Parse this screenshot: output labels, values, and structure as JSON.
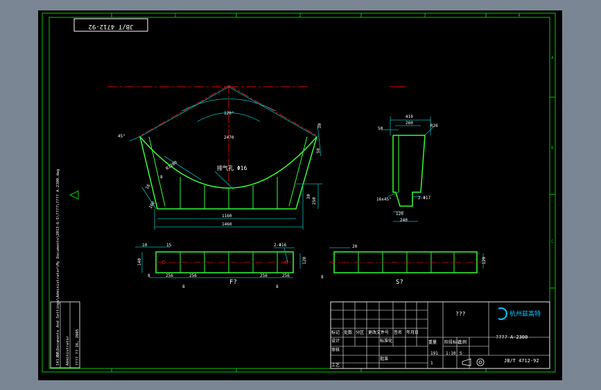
{
  "drawing": {
    "standard_box": "JB/T 4712-92",
    "grid_cols": [
      "1",
      "2",
      "3",
      "4"
    ],
    "grid_rows": [
      "A",
      "B",
      "C"
    ],
    "side_note": "C:\\Documents And Settings\\Administrator\\My Documents\\2013-6-5\\????\\???? A-2300.dwg",
    "front_view": {
      "angle_top": "120°",
      "radius_center": "2470",
      "radius_arc": "R1280",
      "vent_label": "排气孔 Φ16",
      "angle_left": "45°",
      "dim_inner": "1160",
      "dim_outer": "1460",
      "dim_h1": "250",
      "dim_h2": "30",
      "dim_left": "16",
      "dim_left2": "100",
      "dim_right_top": "30",
      "dim_right_mid": "50",
      "dim_left_tag": "8"
    },
    "side_view": {
      "dim_top": "410",
      "dim_top2": "260",
      "dim_left": "50",
      "dim_angle": "R26",
      "chamfer": "16x45°",
      "hole": "2-Φ17",
      "dim_bot1": "120",
      "dim_bot2": "240"
    },
    "view_f": {
      "label": "F?",
      "d1": "10",
      "d2": "15",
      "holes": "2-Φ16",
      "h_left": "140",
      "h_right": "120",
      "s1": "8",
      "s2": "256",
      "s3": "256",
      "s4": "256",
      "s5": "256",
      "s6": "8",
      "t1": "8",
      "t2": "8"
    },
    "view_s": {
      "label": "S?",
      "d1": "20",
      "h_right": "120"
    }
  },
  "title_block": {
    "name": "???",
    "company": "杭州兹高特",
    "part_no": "???? A-2300",
    "standard": "JB/T 4712-92",
    "cells": [
      "标记",
      "处数",
      "分区",
      "更改文件号",
      "签名",
      "年月日",
      "设计",
      "标准化",
      "审核",
      "工艺",
      "批准",
      "阶段标记",
      "重量",
      "比例",
      "共",
      "张",
      "第",
      "张"
    ],
    "values": [
      "191",
      "1:10",
      "S",
      "1"
    ]
  },
  "left_block": {
    "lines": [
      "141.08",
      "Administrator",
      "???? ?? 26, 2005"
    ]
  },
  "colors": {
    "border": "#00cc00",
    "dim": "#00bbbb",
    "center": "#dd0000",
    "outline": "#33ff33",
    "text": "#ffffff"
  }
}
